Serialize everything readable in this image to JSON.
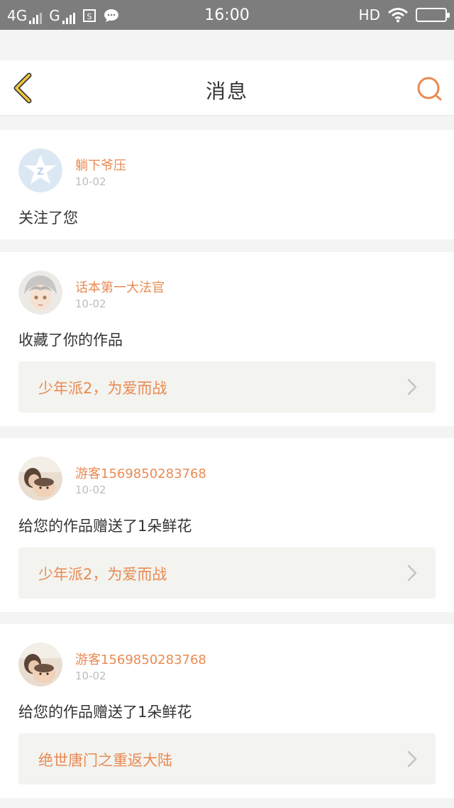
{
  "status_bar": {
    "network1": "4G",
    "network2": "G",
    "time": "16:00",
    "hd": "HD"
  },
  "header": {
    "title": "消息",
    "back_icon": "chevron-left-icon",
    "search_icon": "search-icon"
  },
  "colors": {
    "accent": "#e98a52",
    "back_icon": "#f3c93a",
    "page_bg": "#f4f4f4",
    "work_bg": "#f3f3ef"
  },
  "messages": [
    {
      "avatar": "qzone-star-avatar",
      "user": "躺下爷压",
      "date": "10-02",
      "text": "关注了您"
    },
    {
      "avatar": "anime-character-avatar",
      "user": "话本第一大法官",
      "date": "10-02",
      "text": "收藏了你的作品",
      "work": "少年派2，为爱而战"
    },
    {
      "avatar": "photo-avatar",
      "user": "游客1569850283768",
      "date": "10-02",
      "text": "给您的作品赠送了1朵鲜花",
      "work": "少年派2，为爱而战"
    },
    {
      "avatar": "photo-avatar",
      "user": "游客1569850283768",
      "date": "10-02",
      "text": "给您的作品赠送了1朵鲜花",
      "work": "绝世唐门之重返大陆"
    }
  ]
}
